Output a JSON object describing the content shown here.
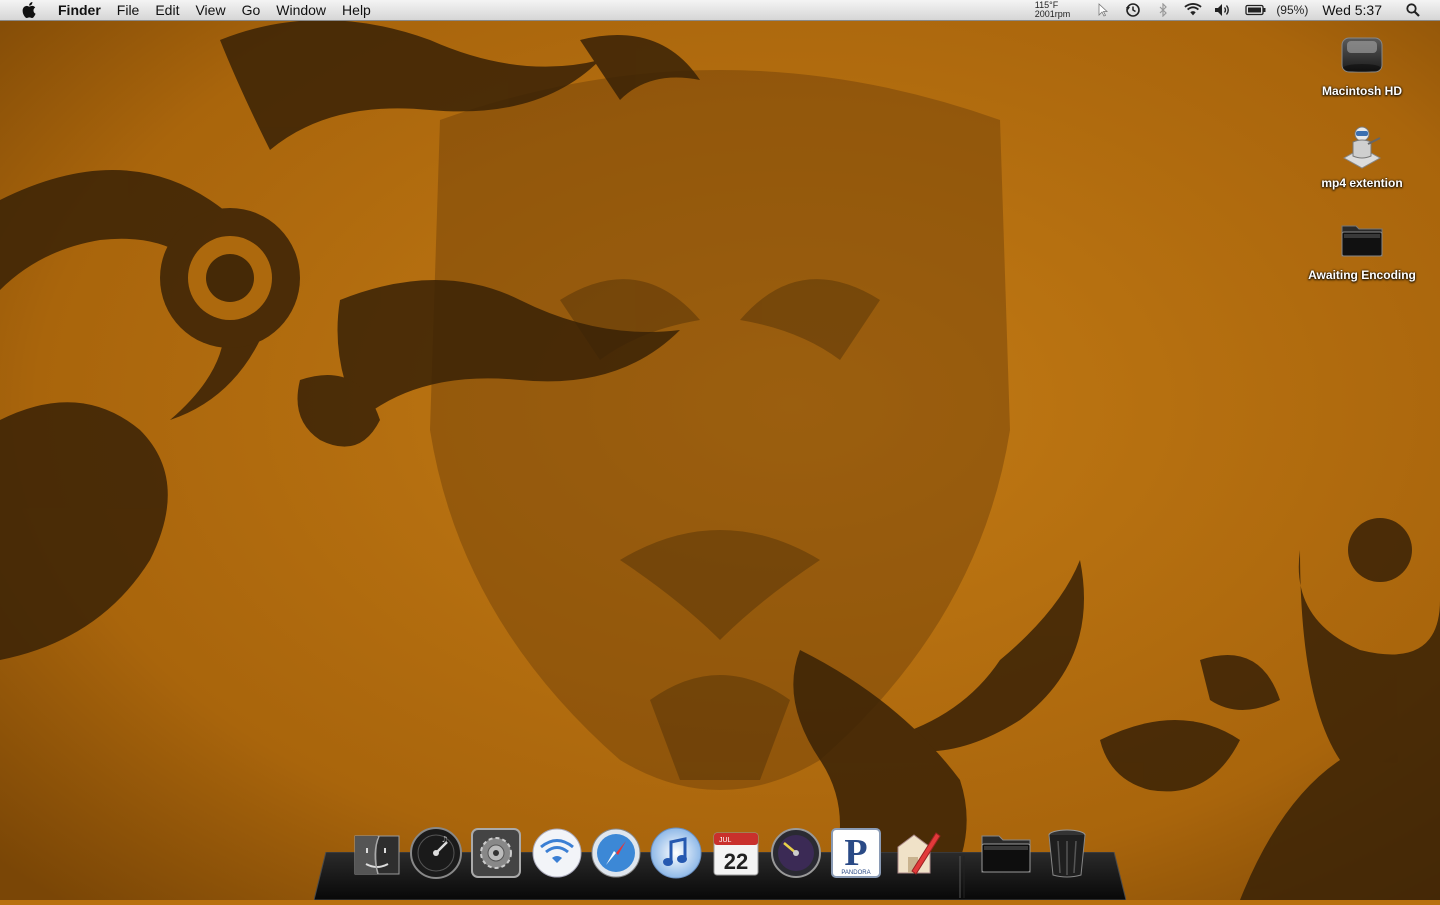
{
  "menubar": {
    "app_name": "Finder",
    "menus": [
      "File",
      "Edit",
      "View",
      "Go",
      "Window",
      "Help"
    ],
    "temperature": "115°F",
    "fan_speed": "2001rpm",
    "battery_percent": "(95%)",
    "clock": "Wed 5:37"
  },
  "desktop": {
    "icons": [
      {
        "label": "Macintosh HD",
        "icon": "hard-drive-icon"
      },
      {
        "label": "mp4 extention",
        "icon": "automator-icon"
      },
      {
        "label": "Awaiting Encoding",
        "icon": "folder-icon"
      }
    ]
  },
  "dock": {
    "items": [
      {
        "name": "Finder",
        "icon": "finder-icon"
      },
      {
        "name": "Dashboard",
        "icon": "dashboard-icon"
      },
      {
        "name": "System Preferences",
        "icon": "system-preferences-icon"
      },
      {
        "name": "AirPort Utility",
        "icon": "wifi-icon"
      },
      {
        "name": "Safari",
        "icon": "safari-icon"
      },
      {
        "name": "iTunes",
        "icon": "itunes-icon"
      },
      {
        "name": "iCal",
        "icon": "calendar-icon"
      },
      {
        "name": "Activity Monitor",
        "icon": "gauge-icon"
      },
      {
        "name": "Pandora",
        "icon": "pandora-icon"
      },
      {
        "name": "TextEdit",
        "icon": "textedit-icon"
      },
      {
        "name": "Folder",
        "icon": "folder-icon"
      },
      {
        "name": "Trash",
        "icon": "trash-icon"
      }
    ],
    "calendar_month": "JUL",
    "calendar_day": "22",
    "pandora_label": "PANDORA",
    "pandora_letter": "P"
  },
  "colors": {
    "wallpaper": "#b8700e",
    "wallpaper_dark": "#3a2206",
    "menubar": "#e8e8e8"
  }
}
